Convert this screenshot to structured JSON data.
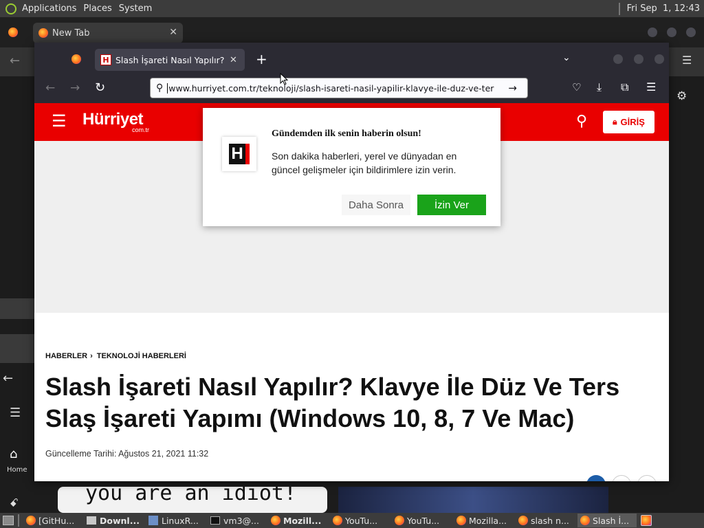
{
  "top_panel": {
    "menus": [
      "Applications",
      "Places",
      "System"
    ],
    "clock": "Fri Sep  1, 12:43"
  },
  "background_browser": {
    "tab_title": "New Tab",
    "sidebar_home": "Home"
  },
  "browser": {
    "tab_title": "Slash İşareti Nasıl Yapılır? Kl",
    "url": "www.hurriyet.com.tr/teknoloji/slash-isareti-nasil-yapilir-klavye-ile-duz-ve-ter"
  },
  "site": {
    "logo_text": "Hürriyet",
    "logo_sub": "com.tr",
    "login_label": "GİRİŞ",
    "brand_color": "#e90000"
  },
  "notification_popup": {
    "title": "Gündemden ilk senin haberin olsun!",
    "body": "Son dakika haberleri, yerel ve dünyadan en güncel gelişmeler için bildirimlere izin verin.",
    "later_label": "Daha Sonra",
    "allow_label": "İzin Ver",
    "allow_color": "#1aa31a"
  },
  "article": {
    "breadcrumb": [
      "HABERLER",
      "TEKNOLOJİ HABERLERİ"
    ],
    "title": "Slash İşareti Nasıl Yapılır? Klavye İle Düz Ve Ters Slaş İşareti Yapımı (Windows 10, 8, 7 Ve Mac)",
    "updated": "Güncelleme Tarihi: Ağustos 21, 2021 11:32"
  },
  "background_video": {
    "caption": "you are an idiot!"
  },
  "taskbar": {
    "tasks": [
      "[GitHu...",
      "Downl...",
      "LinuxR...",
      "vm3@...",
      "Mozill...",
      "YouTu...",
      "YouTu...",
      "Mozilla...",
      "slash n...",
      "Slash İ..."
    ]
  }
}
